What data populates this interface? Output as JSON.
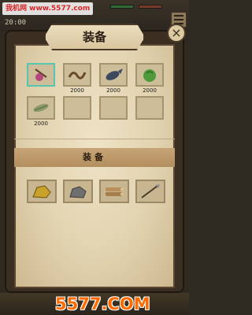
{
  "watermark_top": "我机网 www.5577.com",
  "timer": "20:00",
  "title": "装备",
  "close_symbol": "×",
  "inventory": [
    {
      "name": "pink-berry",
      "count": "",
      "selected": true
    },
    {
      "name": "rope",
      "count": "2000",
      "selected": false
    },
    {
      "name": "fish",
      "count": "2000",
      "selected": false
    },
    {
      "name": "green-cabbage",
      "count": "2000",
      "selected": false
    },
    {
      "name": "corn",
      "count": "2000",
      "selected": false
    }
  ],
  "section": {
    "title": "装备"
  },
  "crafting": [
    "gold-ore",
    "stone",
    "wood-logs",
    "spear"
  ],
  "watermark_bottom": "5577.COM",
  "colors": {
    "parchment": "#e2d3b0",
    "selected_border": "#56c6b1",
    "header": "#b38e5e"
  }
}
